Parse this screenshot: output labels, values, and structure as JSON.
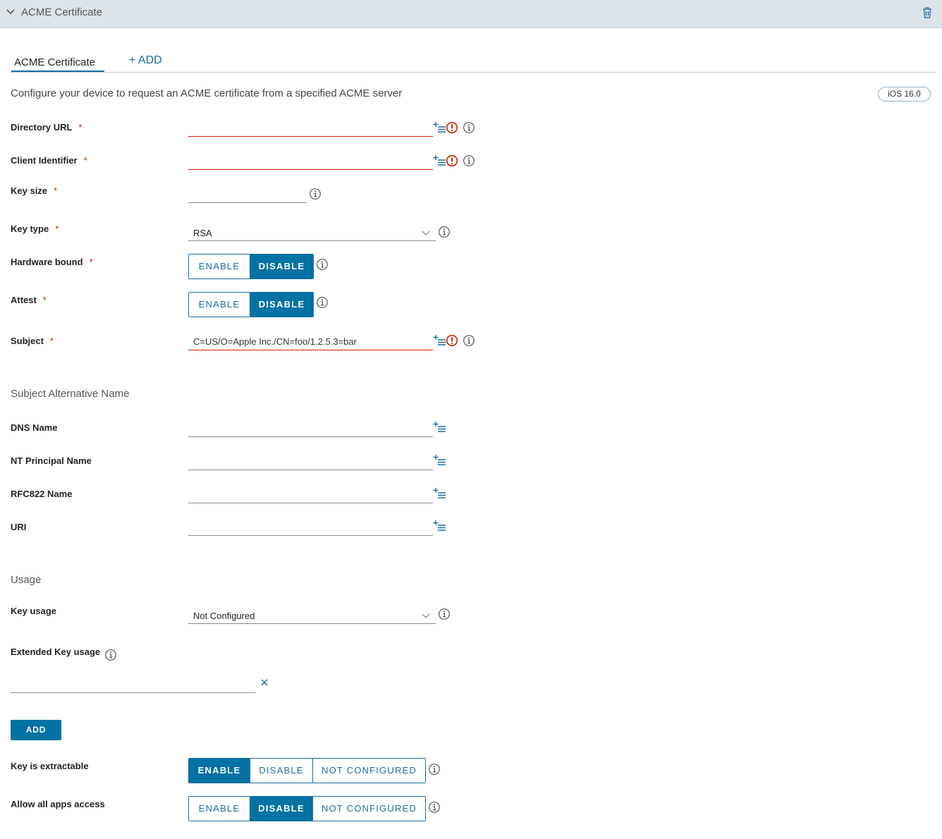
{
  "header": {
    "title": "ACME Certificate"
  },
  "tabs": {
    "active": "ACME Certificate",
    "add": "+ ADD"
  },
  "description": "Configure your device to request an ACME certificate from a specified ACME server",
  "badge": "iOS 16.0",
  "required_mark": "*",
  "fields": {
    "directory_url": {
      "label": "Directory URL",
      "value": ""
    },
    "client_identifier": {
      "label": "Client Identifier",
      "value": ""
    },
    "key_size": {
      "label": "Key size",
      "value": ""
    },
    "key_type": {
      "label": "Key type",
      "value": "RSA"
    },
    "hardware_bound": {
      "label": "Hardware bound",
      "selected": "DISABLE"
    },
    "attest": {
      "label": "Attest",
      "selected": "DISABLE"
    },
    "subject": {
      "label": "Subject",
      "value": "C=US/O=Apple Inc./CN=foo/1.2.5.3=bar"
    }
  },
  "san": {
    "title": "Subject Alternative Name",
    "dns_name": "DNS Name",
    "nt_principal_name": "NT Principal Name",
    "rfc822_name": "RFC822 Name",
    "uri": "URI"
  },
  "usage": {
    "title": "Usage",
    "key_usage": {
      "label": "Key usage",
      "value": "Not Configured"
    },
    "extended_key_usage": {
      "label": "Extended Key usage",
      "value": ""
    },
    "add_button": "ADD",
    "key_is_extractable": {
      "label": "Key is extractable",
      "selected": "ENABLE"
    },
    "allow_all_apps_access": {
      "label": "Allow all apps access",
      "selected": "DISABLE"
    }
  },
  "toggle_labels": {
    "enable": "ENABLE",
    "disable": "DISABLE",
    "not_configured": "NOT CONFIGURED"
  },
  "colors": {
    "accent": "#0072a3",
    "error": "#c92100",
    "header_bg": "#dce3e9"
  },
  "icons": [
    "chevron-down-icon",
    "trash-icon",
    "insert-lookup-icon",
    "error-icon",
    "info-icon",
    "clear-icon"
  ]
}
